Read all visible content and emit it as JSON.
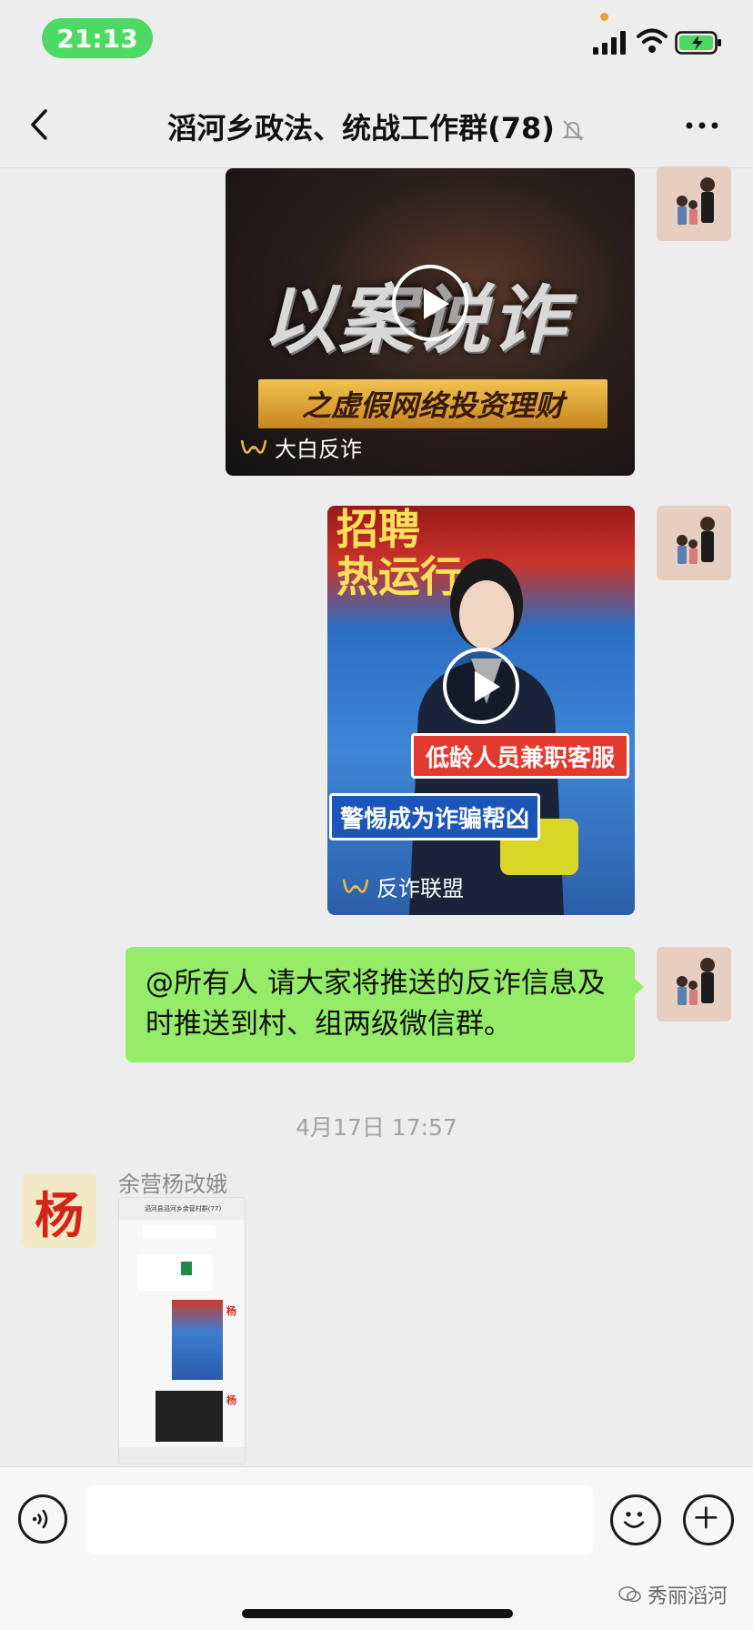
{
  "status_bar": {
    "time": "21:13",
    "accent": "#4cd964"
  },
  "nav": {
    "title": "滔河乡政法、统战工作群(78)",
    "back_icon": "chevron-left-icon",
    "mute_icon": "bell-slash-icon",
    "more_icon": "ellipsis-icon"
  },
  "messages": [
    {
      "type": "video",
      "direction": "sent",
      "title_lettering": "以案说诈",
      "subtitle": "之虚假网络投资理财",
      "source": "大白反诈"
    },
    {
      "type": "video",
      "direction": "sent",
      "top_lettering": "招聘\n热运行",
      "banner_red": "低龄人员兼职客服",
      "banner_blue": "警惕成为诈骗帮凶",
      "source": "反诈联盟"
    },
    {
      "type": "text",
      "direction": "sent",
      "text": "@所有人 请大家将推送的反诈信息及时推送到村、组两级微信群。"
    }
  ],
  "timestamp": "4月17日 17:57",
  "received": {
    "avatar_char": "杨",
    "sender_name": "余营杨改娥",
    "screenshot": {
      "header": "滔河县滔河乡余营村群(77)",
      "tag": "杨"
    }
  },
  "input_bar": {
    "voice_icon": "voice-icon",
    "emoji_icon": "smile-icon",
    "plus_icon": "plus-icon"
  },
  "watermark": "秀丽滔河",
  "colors": {
    "bubble_green": "#95ec69",
    "background": "#ededed"
  }
}
